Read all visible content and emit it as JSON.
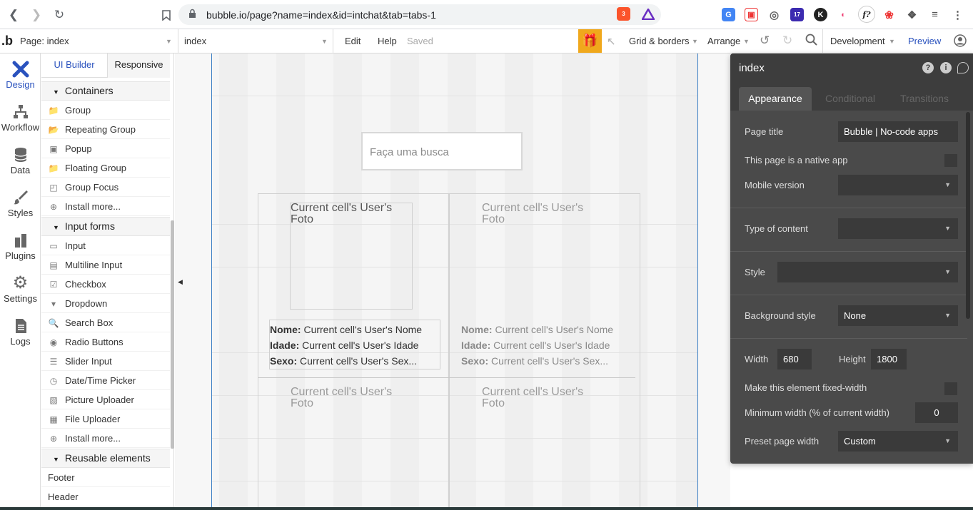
{
  "browser": {
    "url": "bubble.io/page?name=index&id=intchat&tab=tabs-1",
    "ext_badge_brave": "3",
    "ext_badge_calendar": "17"
  },
  "topbar": {
    "page_label": "Page: index",
    "page_select_value": "index",
    "menu_edit": "Edit",
    "menu_help": "Help",
    "save_status": "Saved",
    "grid_borders": "Grid & borders",
    "arrange": "Arrange",
    "env": "Development",
    "preview": "Preview"
  },
  "rail": {
    "items": [
      {
        "label": "Design",
        "icon": "design-icon"
      },
      {
        "label": "Workflow",
        "icon": "workflow-icon"
      },
      {
        "label": "Data",
        "icon": "data-icon"
      },
      {
        "label": "Styles",
        "icon": "styles-icon"
      },
      {
        "label": "Plugins",
        "icon": "plugins-icon"
      },
      {
        "label": "Settings",
        "icon": "settings-icon"
      },
      {
        "label": "Logs",
        "icon": "logs-icon"
      }
    ]
  },
  "palette": {
    "tabs": [
      "UI Builder",
      "Responsive"
    ],
    "sections": {
      "containers": "Containers",
      "input_forms": "Input forms",
      "reusable": "Reusable elements"
    },
    "containers": [
      "Group",
      "Repeating Group",
      "Popup",
      "Floating Group",
      "Group Focus",
      "Install more..."
    ],
    "inputs": [
      "Input",
      "Multiline Input",
      "Checkbox",
      "Dropdown",
      "Search Box",
      "Radio Buttons",
      "Slider Input",
      "Date/Time Picker",
      "Picture Uploader",
      "File Uploader",
      "Install more..."
    ],
    "reusable": [
      "Footer",
      "Header"
    ]
  },
  "canvas": {
    "search_placeholder": "Faça uma busca",
    "foto_line1": "Current cell's User's",
    "foto_line2": "Foto",
    "nome_label": "Nome:",
    "nome_value": "Current cell's User's Nome",
    "idade_label": "Idade:",
    "idade_value": "Current cell's User's Idade",
    "sexo_label": "Sexo:",
    "sexo_value": "Current cell's User's Sex..."
  },
  "properties": {
    "title": "index",
    "tabs": [
      "Appearance",
      "Conditional",
      "Transitions"
    ],
    "page_title_label": "Page title",
    "page_title_value": "Bubble | No-code apps",
    "native_app_label": "This page is a native app",
    "mobile_version_label": "Mobile version",
    "type_of_content_label": "Type of content",
    "style_label": "Style",
    "background_style_label": "Background style",
    "background_style_value": "None",
    "width_label": "Width",
    "width_value": "680",
    "height_label": "Height",
    "height_value": "1800",
    "fixed_width_label": "Make this element fixed-width",
    "min_width_label": "Minimum width (% of current width)",
    "min_width_value": "0",
    "preset_width_label": "Preset page width",
    "preset_width_value": "Custom"
  }
}
